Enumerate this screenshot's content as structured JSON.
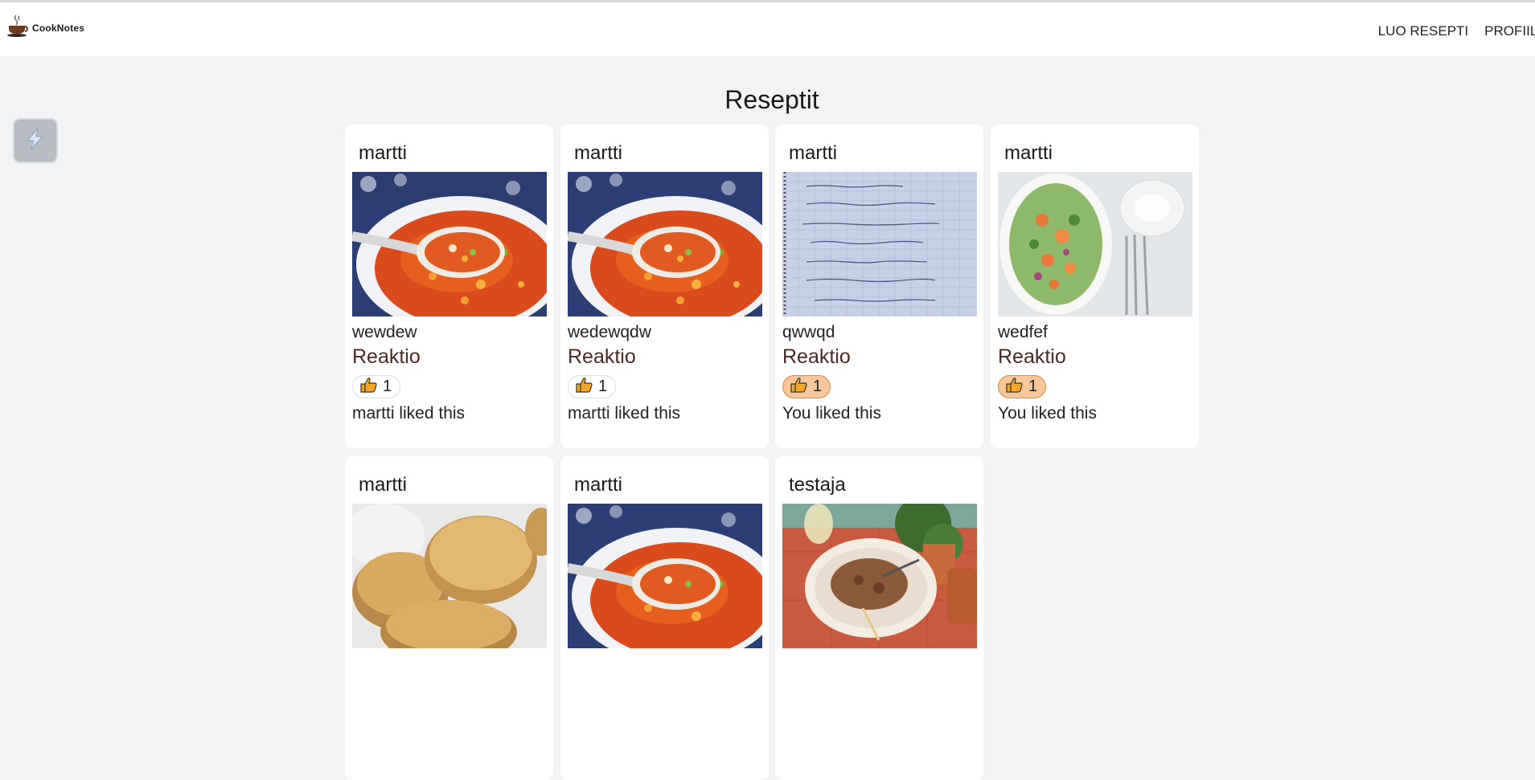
{
  "app": {
    "name": "CookNotes"
  },
  "nav": {
    "create_recipe": "LUO RESEPTI",
    "profile": "PROFIILI"
  },
  "page": {
    "title": "Reseptit"
  },
  "colors": {
    "accent": "#f7c79a",
    "background": "#f2f3f5",
    "card": "#ffffff"
  },
  "cards": [
    {
      "author": "martti",
      "name": "wewdew",
      "reaction_label": "Reaktio",
      "icon": "thumbs-up-icon",
      "likes": "1",
      "liked_by": "martti liked this",
      "active": false,
      "image": "soup"
    },
    {
      "author": "martti",
      "name": "wedewqdw",
      "reaction_label": "Reaktio",
      "icon": "thumbs-up-icon",
      "likes": "1",
      "liked_by": "martti liked this",
      "active": false,
      "image": "soup"
    },
    {
      "author": "martti",
      "name": "qwwqd",
      "reaction_label": "Reaktio",
      "icon": "thumbs-up-icon",
      "likes": "1",
      "liked_by": "You liked this",
      "active": true,
      "image": "notebook"
    },
    {
      "author": "martti",
      "name": "wedfef",
      "reaction_label": "Reaktio",
      "icon": "thumbs-up-icon",
      "likes": "1",
      "liked_by": "You liked this",
      "active": true,
      "image": "salad"
    },
    {
      "author": "martti",
      "image": "bread"
    },
    {
      "author": "martti",
      "image": "soup"
    },
    {
      "author": "testaja",
      "image": "spaghetti"
    }
  ]
}
